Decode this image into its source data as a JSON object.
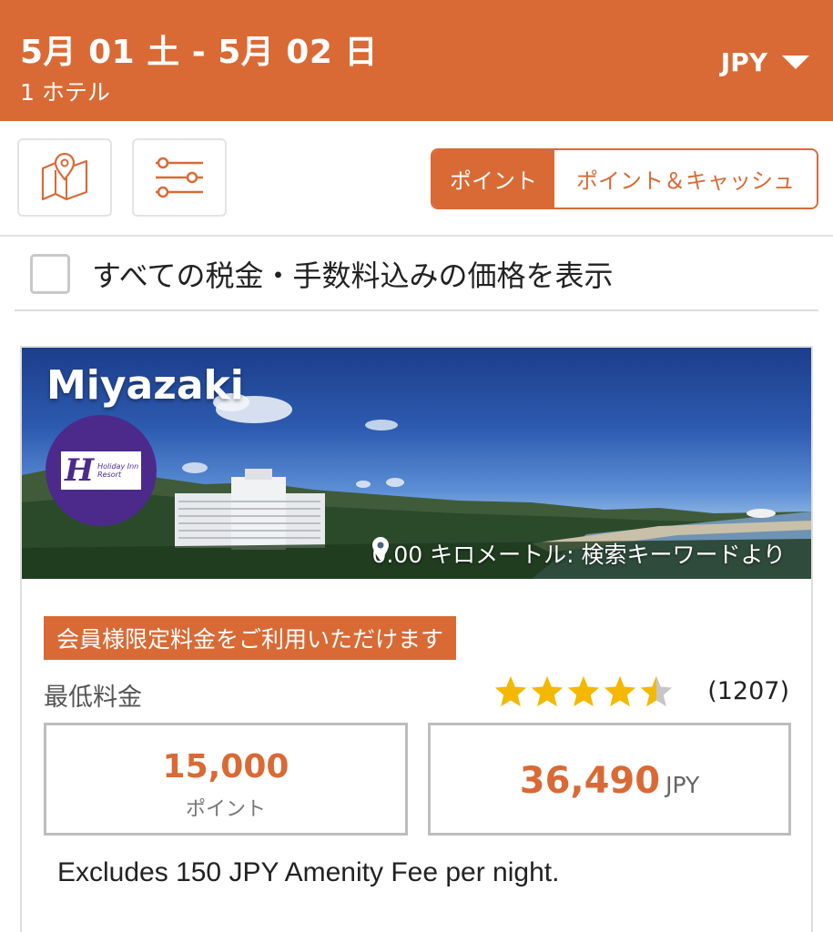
{
  "header": {
    "dates": "5月 01 土 - 5月 02 日",
    "hotel_count": "1 ホテル",
    "currency": "JPY"
  },
  "toolbar": {
    "map_icon": "map-pin-icon",
    "filter_icon": "sliders-icon",
    "payment_options": [
      "ポイント",
      "ポイント＆キャッシュ"
    ],
    "selected_payment": "ポイント"
  },
  "tax_toggle": {
    "label": "すべての税金・手数料込みの価格を表示",
    "checked": false
  },
  "hotel": {
    "city": "Miyazaki",
    "brand_logo_text": "Holiday Inn Resort",
    "distance": "0.00 キロメートル: 検索キーワードより",
    "member_badge": "会員様限定料金をご利用いただけます",
    "lowest_rate_label": "最低料金",
    "rating": 4.5,
    "review_count": "(1207)",
    "points_price": "15,000",
    "points_unit": "ポイント",
    "cash_price": "36,490",
    "cash_currency": "JPY",
    "fee_note": "Excludes 150 JPY Amenity Fee per night."
  },
  "colors": {
    "brand_orange": "#d96a35",
    "star_gold": "#f5b800",
    "star_empty": "#c6c6c6",
    "logo_purple": "#4b2a8c"
  }
}
